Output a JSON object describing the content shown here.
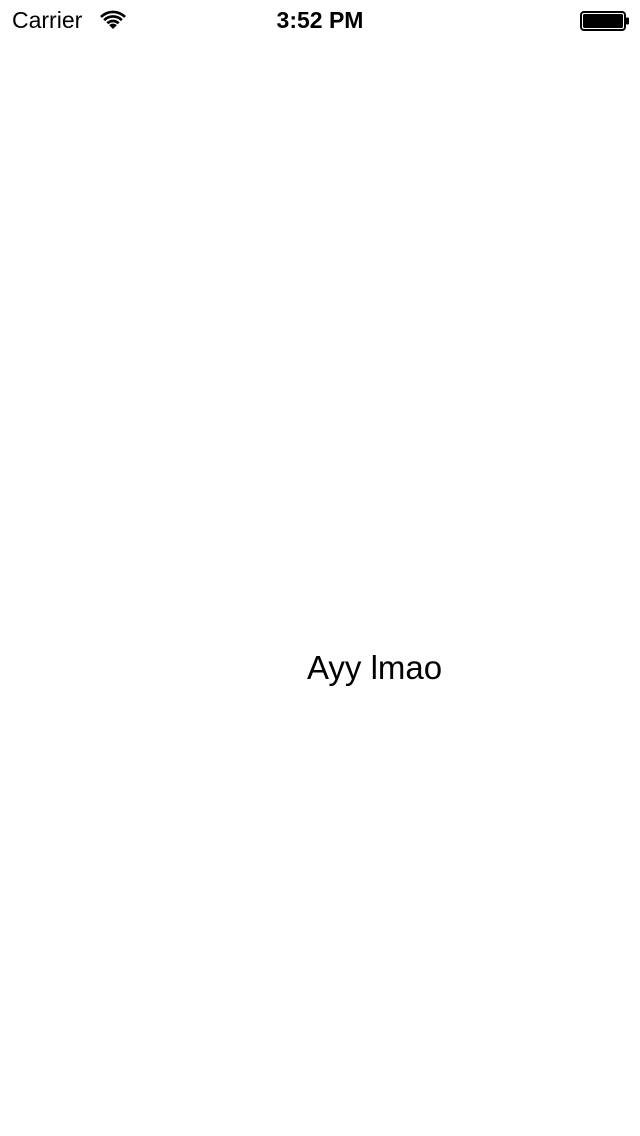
{
  "status_bar": {
    "carrier": "Carrier",
    "time": "3:52 PM",
    "wifi_icon": "wifi-icon",
    "battery_icon": "battery-icon",
    "battery_level": 1.0
  },
  "main": {
    "label": "Ayy lmao"
  }
}
